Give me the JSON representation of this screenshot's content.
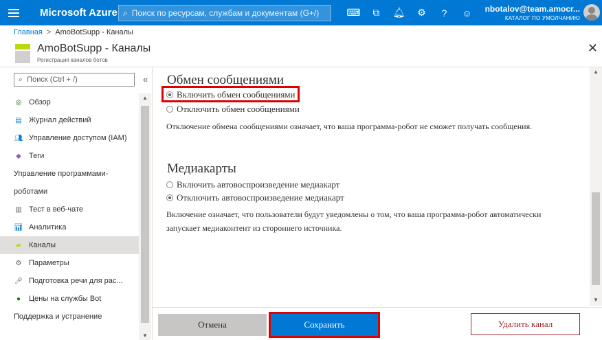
{
  "topbar": {
    "brand": "Microsoft Azure",
    "search_placeholder": "Поиск по ресурсам, службам и документам (G+/)",
    "icons": [
      "cloud-shell-icon",
      "directory-filter-icon",
      "bell-icon",
      "gear-icon",
      "help-icon",
      "feedback-smiley-icon"
    ],
    "user_email": "nbotalov@team.amocr...",
    "user_directory": "КАТАЛОГ ПО УМОЛЧАНИЮ",
    "accent_color": "#0078d4"
  },
  "breadcrumb": {
    "home": "Главная",
    "separator": ">",
    "current": "AmoBotSupp - Каналы"
  },
  "header": {
    "title": "AmoBotSupp - Каналы",
    "subtitle": "Регистрация каналов ботов",
    "close": "✕"
  },
  "leftnav": {
    "search_placeholder": "Поиск (Ctrl + /)",
    "collapse": "«",
    "items": [
      {
        "label": "Обзор",
        "icon": "overview-icon",
        "type": "item"
      },
      {
        "label": "Журнал действий",
        "icon": "activity-log-icon",
        "type": "item"
      },
      {
        "label": "Управление доступом (IAM)",
        "icon": "iam-icon",
        "type": "item"
      },
      {
        "label": "Теги",
        "icon": "tag-icon",
        "type": "item"
      },
      {
        "label": "Управление программами-",
        "type": "section"
      },
      {
        "label": "роботами",
        "type": "section"
      },
      {
        "label": "Тест в веб-чате",
        "icon": "webchat-test-icon",
        "type": "item"
      },
      {
        "label": "Аналитика",
        "icon": "analytics-icon",
        "type": "item"
      },
      {
        "label": "Каналы",
        "icon": "channels-icon",
        "type": "item",
        "active": true
      },
      {
        "label": "Параметры",
        "icon": "settings-icon",
        "type": "item"
      },
      {
        "label": "Подготовка речи для рас...",
        "icon": "speech-priming-icon",
        "type": "item"
      },
      {
        "label": "Цены на службы Bot",
        "icon": "pricing-icon",
        "type": "item"
      },
      {
        "label": "Поддержка и устранение",
        "type": "section"
      }
    ]
  },
  "messaging": {
    "heading": "Обмен сообщениями",
    "enable_label": "Включить обмен сообщениями",
    "disable_label": "Отключить обмен сообщениями",
    "selected": "enable",
    "description": "Отключение обмена сообщениями означает, что ваша программа-робот не сможет получать сообщения."
  },
  "mediacards": {
    "heading": "Медиакарты",
    "enable_label": "Включить автовоспроизведение медиакарт",
    "disable_label": "Отключить автовоспроизведение медиакарт",
    "selected": "disable",
    "description_line1": "Включение означает, что пользователи будут уведомлены о том, что ваша программа-робот автоматически",
    "description_line2": "запускает медиаконтент из стороннего источника."
  },
  "footer": {
    "cancel_label": "Отмена",
    "save_label": "Сохранить",
    "delete_label": "Удалить канал"
  },
  "highlight_color": "#e00000"
}
